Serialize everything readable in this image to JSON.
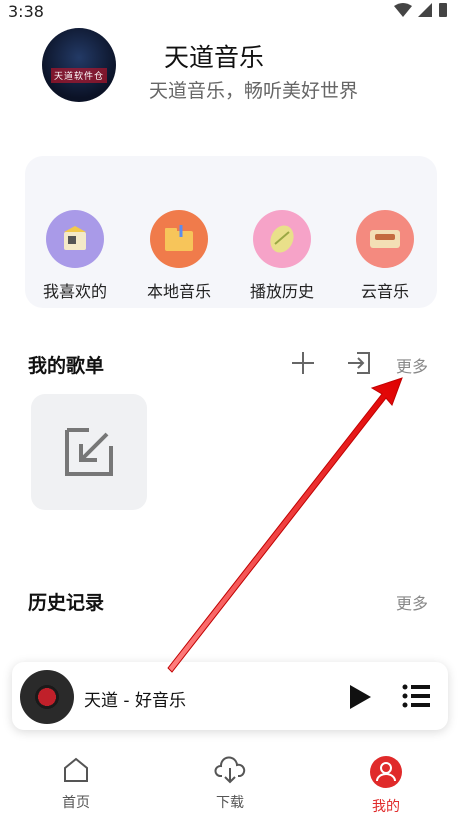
{
  "status": {
    "time": "3:38"
  },
  "profile": {
    "name": "天道音乐",
    "subtitle": "天道音乐，畅听美好世界",
    "avatar_text": "天道软件仓"
  },
  "quick_actions": [
    {
      "label": "我喜欢的",
      "icon": "favorites-icon",
      "color": "#a99ae8"
    },
    {
      "label": "本地音乐",
      "icon": "local-music-icon",
      "color": "#f07b4b"
    },
    {
      "label": "播放历史",
      "icon": "history-icon",
      "color": "#f6a3c8"
    },
    {
      "label": "云音乐",
      "icon": "cloud-music-icon",
      "color": "#f48a7f"
    }
  ],
  "playlists": {
    "title": "我的歌单",
    "more": "更多"
  },
  "history": {
    "title": "历史记录",
    "more": "更多"
  },
  "player": {
    "title": "天道 - 好音乐"
  },
  "tabs": [
    {
      "label": "首页",
      "icon": "home-icon"
    },
    {
      "label": "下载",
      "icon": "download-cloud-icon"
    },
    {
      "label": "我的",
      "icon": "profile-icon",
      "active": true
    }
  ],
  "colors": {
    "accent": "#e02a2a",
    "card_bg": "#f5f6fa"
  }
}
